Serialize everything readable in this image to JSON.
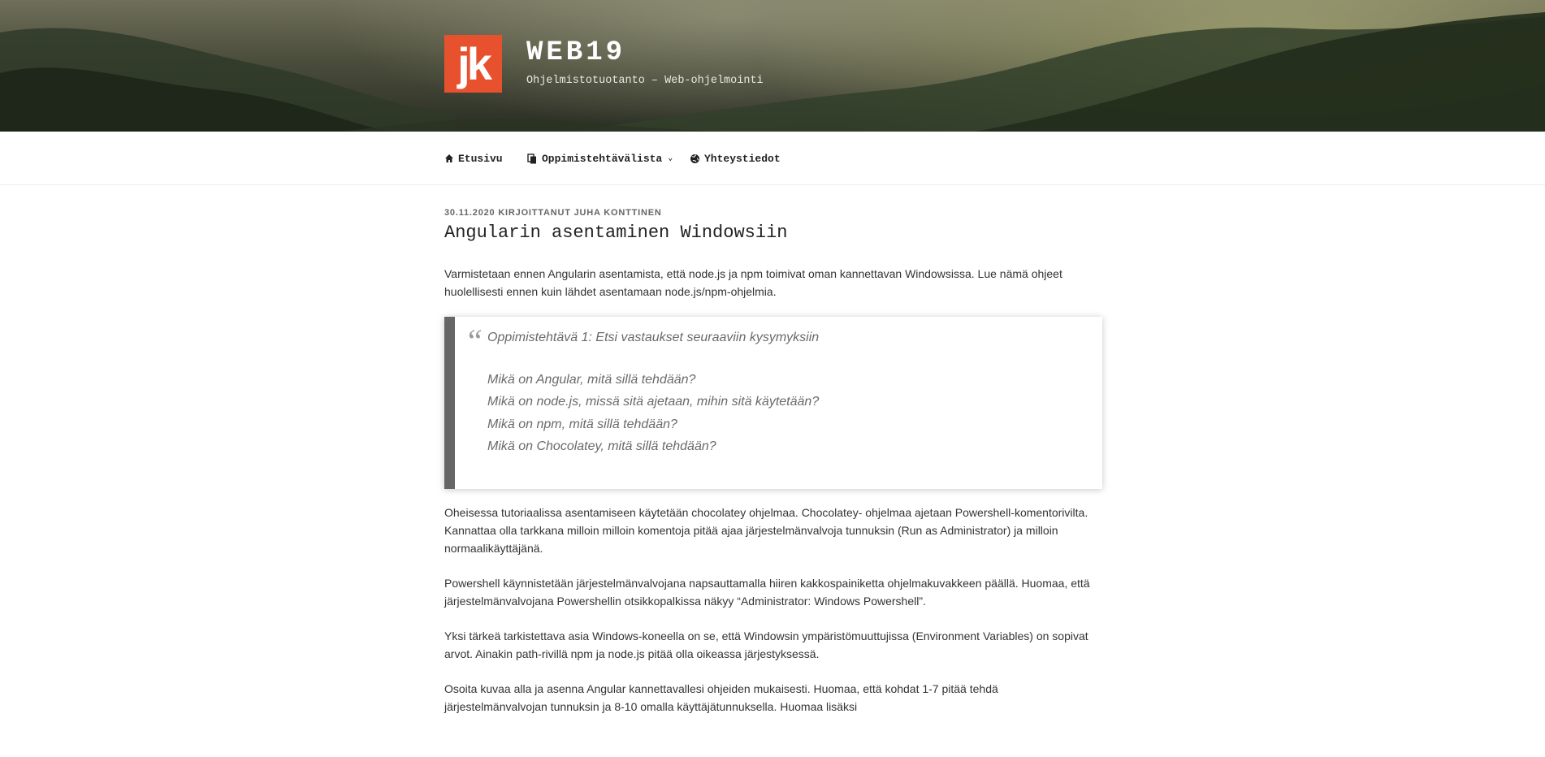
{
  "header": {
    "logo_text": "jk",
    "site_title": "WEB19",
    "site_description": "Ohjelmistotuotanto – Web-ohjelmointi"
  },
  "nav": {
    "items": [
      {
        "label": "Etusivu",
        "icon": "home-icon"
      },
      {
        "label": "Oppimistehtävälista",
        "icon": "documents-icon",
        "has_dropdown": true
      },
      {
        "label": "Yhteystiedot",
        "icon": "globe-icon"
      }
    ]
  },
  "post": {
    "date": "30.11.2020",
    "author_prefix": "Kirjoittanut",
    "author": "Juha Konttinen",
    "title": "Angularin asentaminen Windowsiin",
    "intro": "Varmistetaan ennen Angularin asentamista, että node.js ja npm toimivat oman kannettavan Windowsissa. Lue nämä ohjeet huolellisesti ennen kuin lähdet asentamaan node.js/npm-ohjelmia.",
    "quote": {
      "heading": "Oppimistehtävä 1: Etsi vastaukset seuraaviin kysymyksiin",
      "questions": [
        "Mikä on Angular, mitä sillä tehdään?",
        "Mikä on node.js, missä sitä ajetaan, mihin sitä käytetään?",
        "Mikä on npm, mitä sillä tehdään?",
        "Mikä on Chocolatey, mitä sillä tehdään?"
      ]
    },
    "paragraphs": [
      "Oheisessa tutoriaalissa asentamiseen käytetään chocolatey ohjelmaa. Chocolatey- ohjelmaa ajetaan Powershell-komentorivilta. Kannattaa olla tarkkana milloin milloin komentoja pitää ajaa järjestelmänvalvoja tunnuksin (Run as Administrator) ja milloin normaalikäyttäjänä.",
      "Powershell käynnistetään järjestelmänvalvojana napsauttamalla hiiren kakkospainiketta ohjelmakuvakkeen päällä. Huomaa, että järjestelmänvalvojana Powershellin otsikkopalkissa näkyy “Administrator: Windows Powershell”.",
      "Yksi tärkeä tarkistettava asia Windows-koneella on se, että Windowsin ympäristömuuttujissa (Environment Variables) on sopivat arvot. Ainakin path-rivillä npm ja node.js pitää olla oikeassa järjestyksessä.",
      "Osoita kuvaa alla ja asenna Angular kannettavallesi ohjeiden mukaisesti. Huomaa, että kohdat 1-7 pitää tehdä järjestelmänvalvojan tunnuksin ja 8-10 omalla käyttäjätunnuksella. Huomaa lisäksi"
    ]
  }
}
